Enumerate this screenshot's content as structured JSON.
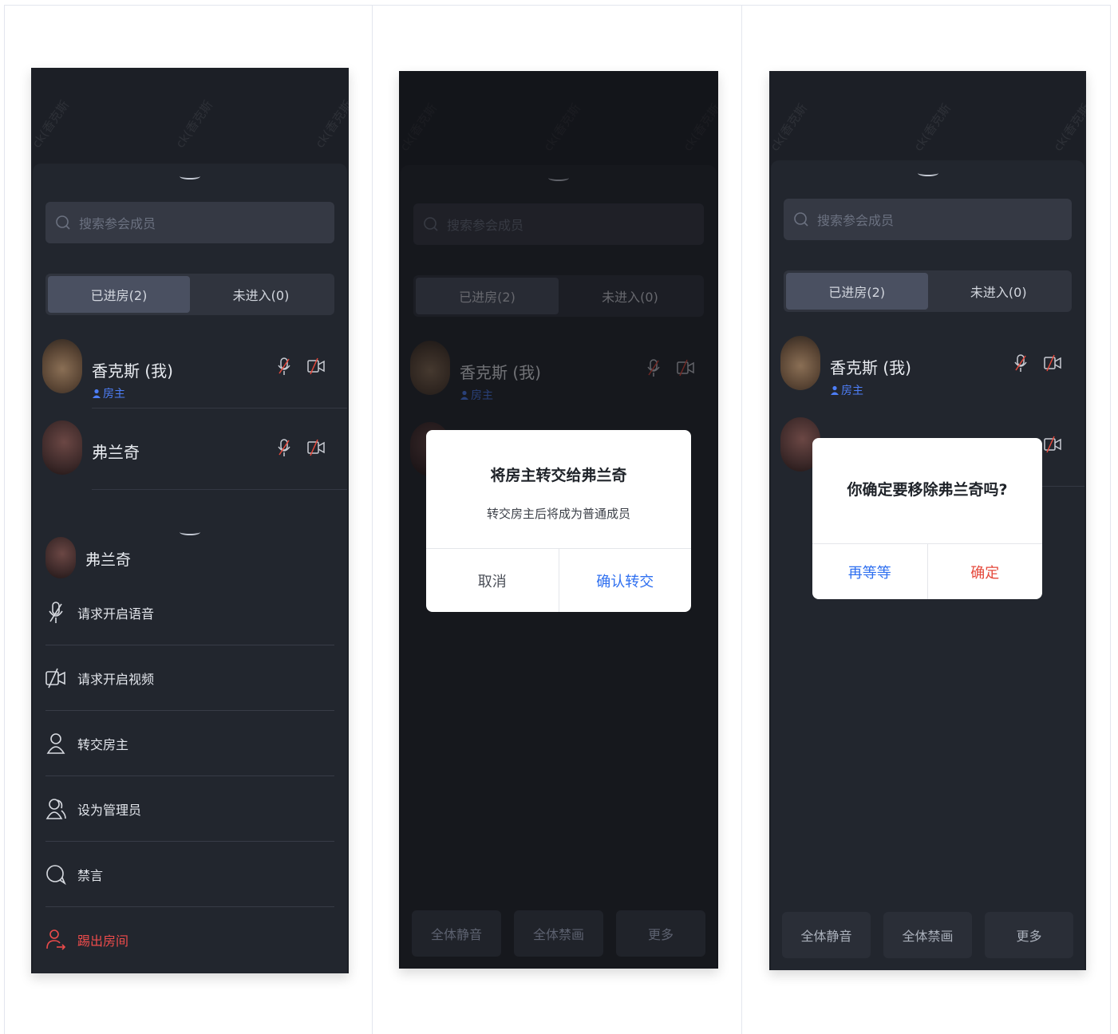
{
  "panels": [
    {
      "search_placeholder": "搜索参会成员",
      "tabs": [
        "已进房(2)",
        "未进入(0)"
      ],
      "members": [
        {
          "name": "香克斯 (我)",
          "role": "房主"
        },
        {
          "name": "弗兰奇"
        }
      ],
      "watermark": "ck(香克斯"
    }
  ],
  "panel1": {
    "action_sheet": {
      "member_name": "弗兰奇",
      "actions": [
        "请求开启语音",
        "请求开启视频",
        "转交房主",
        "设为管理员",
        "禁言",
        "踢出房间"
      ]
    }
  },
  "panel2": {
    "dialog": {
      "title": "将房主转交给弗兰奇",
      "message": "转交房主后将成为普通成员",
      "cancel": "取消",
      "confirm": "确认转交"
    },
    "bottom_buttons": [
      "全体静音",
      "全体禁画",
      "更多"
    ]
  },
  "panel3": {
    "dialog": {
      "title": "你确定要移除弗兰奇吗?",
      "cancel": "再等等",
      "confirm": "确定"
    },
    "bottom_buttons": [
      "全体静音",
      "全体禁画",
      "更多"
    ]
  },
  "colors": {
    "background": "#1c1f26",
    "accent_blue": "#2e6ff0",
    "danger_red": "#e5483b",
    "role_blue": "#4d7ef7"
  }
}
